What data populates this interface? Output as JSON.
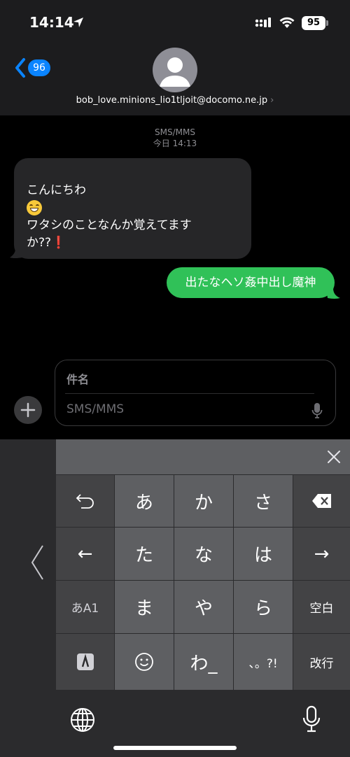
{
  "status_bar": {
    "time": "14:14",
    "battery": "95"
  },
  "header": {
    "back_count": "96",
    "contact": "bob_love.minions_lio1tljoit@docomo.ne.jp",
    "contact_chevron": "›"
  },
  "conversation": {
    "service": "SMS/MMS",
    "timestamp": "今日 14:13",
    "incoming": {
      "line1": "こんにちわ",
      "line3": "ワタシのことなんか覚えてます",
      "line4": "か??",
      "excl": "❗"
    },
    "outgoing": "出たなヘソ姦中出し魔神"
  },
  "compose": {
    "subject_placeholder": "件名",
    "message_placeholder": "SMS/MMS"
  },
  "keyboard": {
    "keys": {
      "a": "あ",
      "ka": "か",
      "sa": "さ",
      "ta": "た",
      "na": "な",
      "ha": "は",
      "ma": "ま",
      "ya": "や",
      "ra": "ら",
      "wa": "わ_",
      "punct": "、。?!",
      "mode": "あA1",
      "space": "空白",
      "enter": "改行",
      "left": "←",
      "right": "→",
      "undo": "↺"
    }
  },
  "colors": {
    "accent": "#0a84ff",
    "outgoing_bubble": "#30c158",
    "incoming_bubble": "#262628"
  },
  "icons": [
    "location-arrow-icon",
    "signal-icon",
    "wifi-icon",
    "back-chevron-icon",
    "person-icon",
    "mic-icon",
    "plus-icon",
    "close-icon",
    "delete-icon",
    "globe-icon",
    "emoji-icon",
    "keyboard-switch-icon"
  ]
}
